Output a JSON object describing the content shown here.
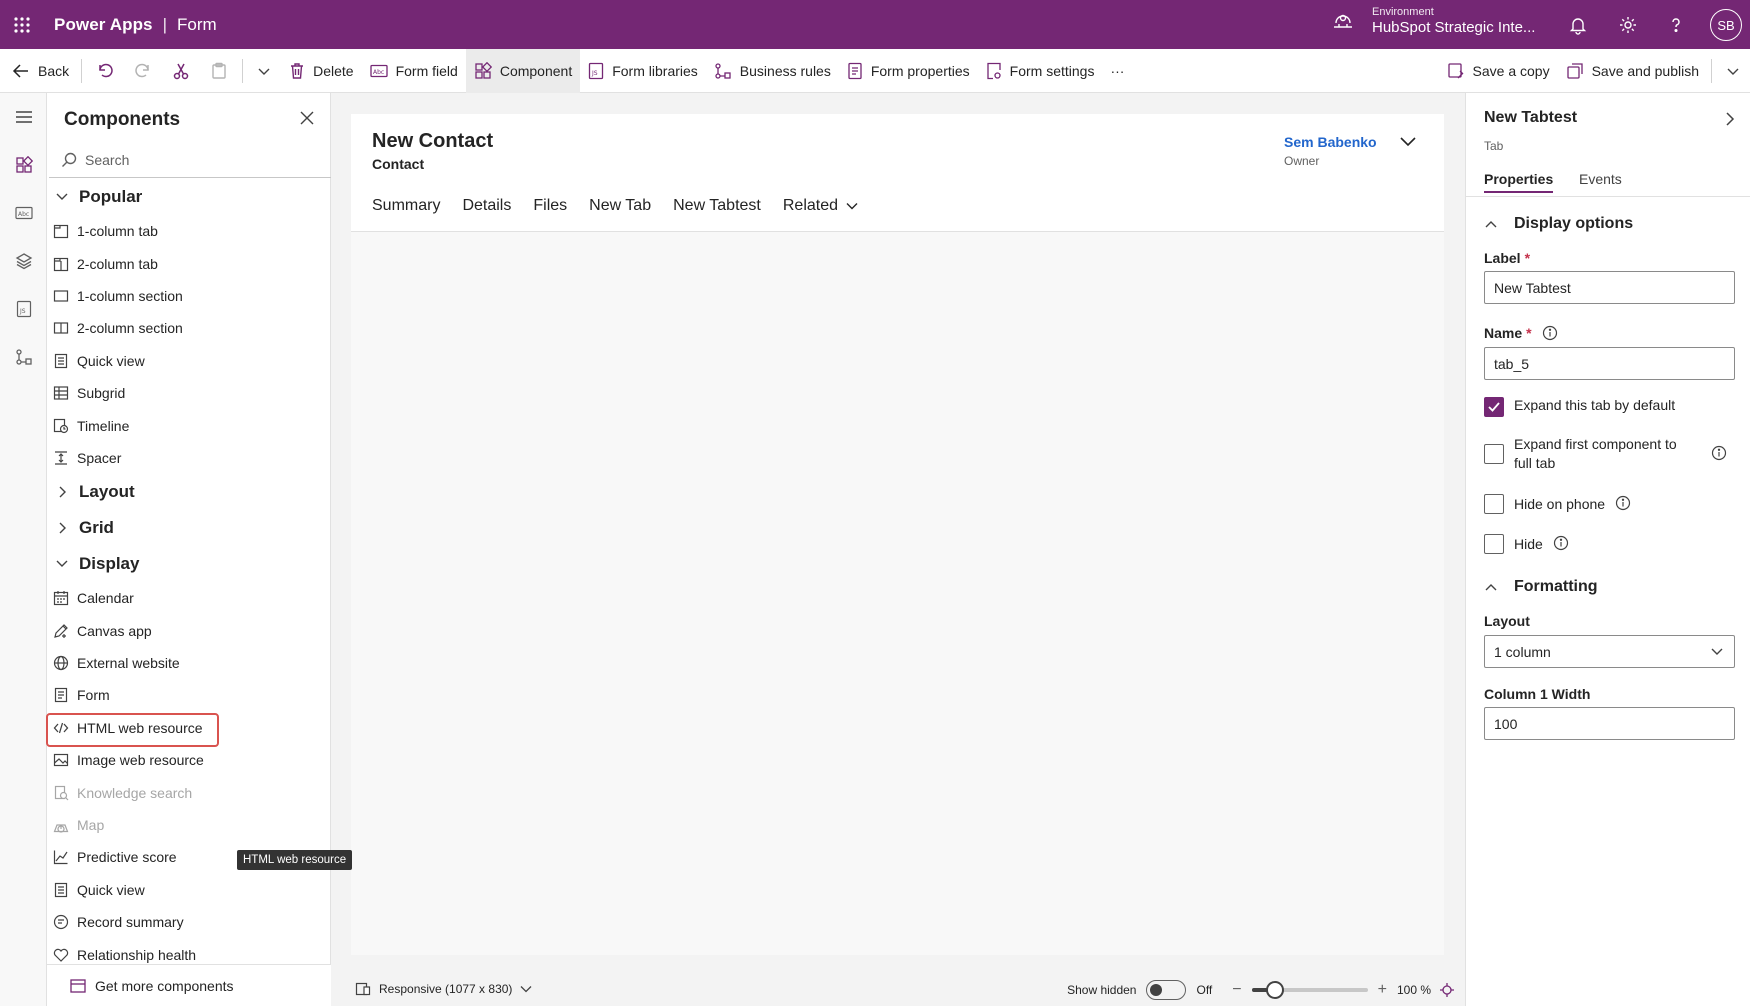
{
  "topbar": {
    "app_name": "Power Apps",
    "separator": "|",
    "section": "Form",
    "environment_label": "Environment",
    "environment_name": "HubSpot Strategic Inte...",
    "avatar_initials": "SB",
    "color": "#742774"
  },
  "commandbar": {
    "back": "Back",
    "delete": "Delete",
    "form_field": "Form field",
    "component": "Component",
    "form_libraries": "Form libraries",
    "business_rules": "Business rules",
    "form_properties": "Form properties",
    "form_settings": "Form settings",
    "more": "···",
    "save_copy": "Save a copy",
    "save_publish": "Save and publish"
  },
  "components_panel": {
    "title": "Components",
    "search_placeholder": "Search",
    "groups": {
      "popular": "Popular",
      "layout": "Layout",
      "grid": "Grid",
      "display": "Display"
    },
    "popular_items": [
      "1-column tab",
      "2-column tab",
      "1-column section",
      "2-column section",
      "Quick view",
      "Subgrid",
      "Timeline",
      "Spacer"
    ],
    "display_items": [
      "Calendar",
      "Canvas app",
      "External website",
      "Form",
      "HTML web resource",
      "Image web resource",
      "Knowledge search",
      "Map",
      "Predictive score",
      "Quick view",
      "Record summary",
      "Relationship health"
    ],
    "tooltip": "HTML web resource",
    "get_more": "Get more components"
  },
  "form": {
    "title": "New Contact",
    "entity": "Contact",
    "owner_name": "Sem Babenko",
    "owner_label": "Owner",
    "tabs": [
      "Summary",
      "Details",
      "Files",
      "New Tab",
      "New Tabtest"
    ],
    "related": "Related"
  },
  "statusbar": {
    "responsive": "Responsive (1077 x 830)",
    "show_hidden": "Show hidden",
    "toggle_state": "Off",
    "zoom": "100 %",
    "zoom_fraction": 0.2
  },
  "properties": {
    "title": "New Tabtest",
    "subtitle": "Tab",
    "tab_properties": "Properties",
    "tab_events": "Events",
    "display_options": "Display options",
    "label_label": "Label",
    "label_value": "New Tabtest",
    "name_label": "Name",
    "name_value": "tab_5",
    "expand_default": "Expand this tab by default",
    "expand_full": "Expand first component to full tab",
    "hide_phone": "Hide on phone",
    "hide": "Hide",
    "formatting": "Formatting",
    "layout_label": "Layout",
    "layout_value": "1 column",
    "col_width_label": "Column 1 Width",
    "col_width_value": "100",
    "required_mark": "*"
  }
}
